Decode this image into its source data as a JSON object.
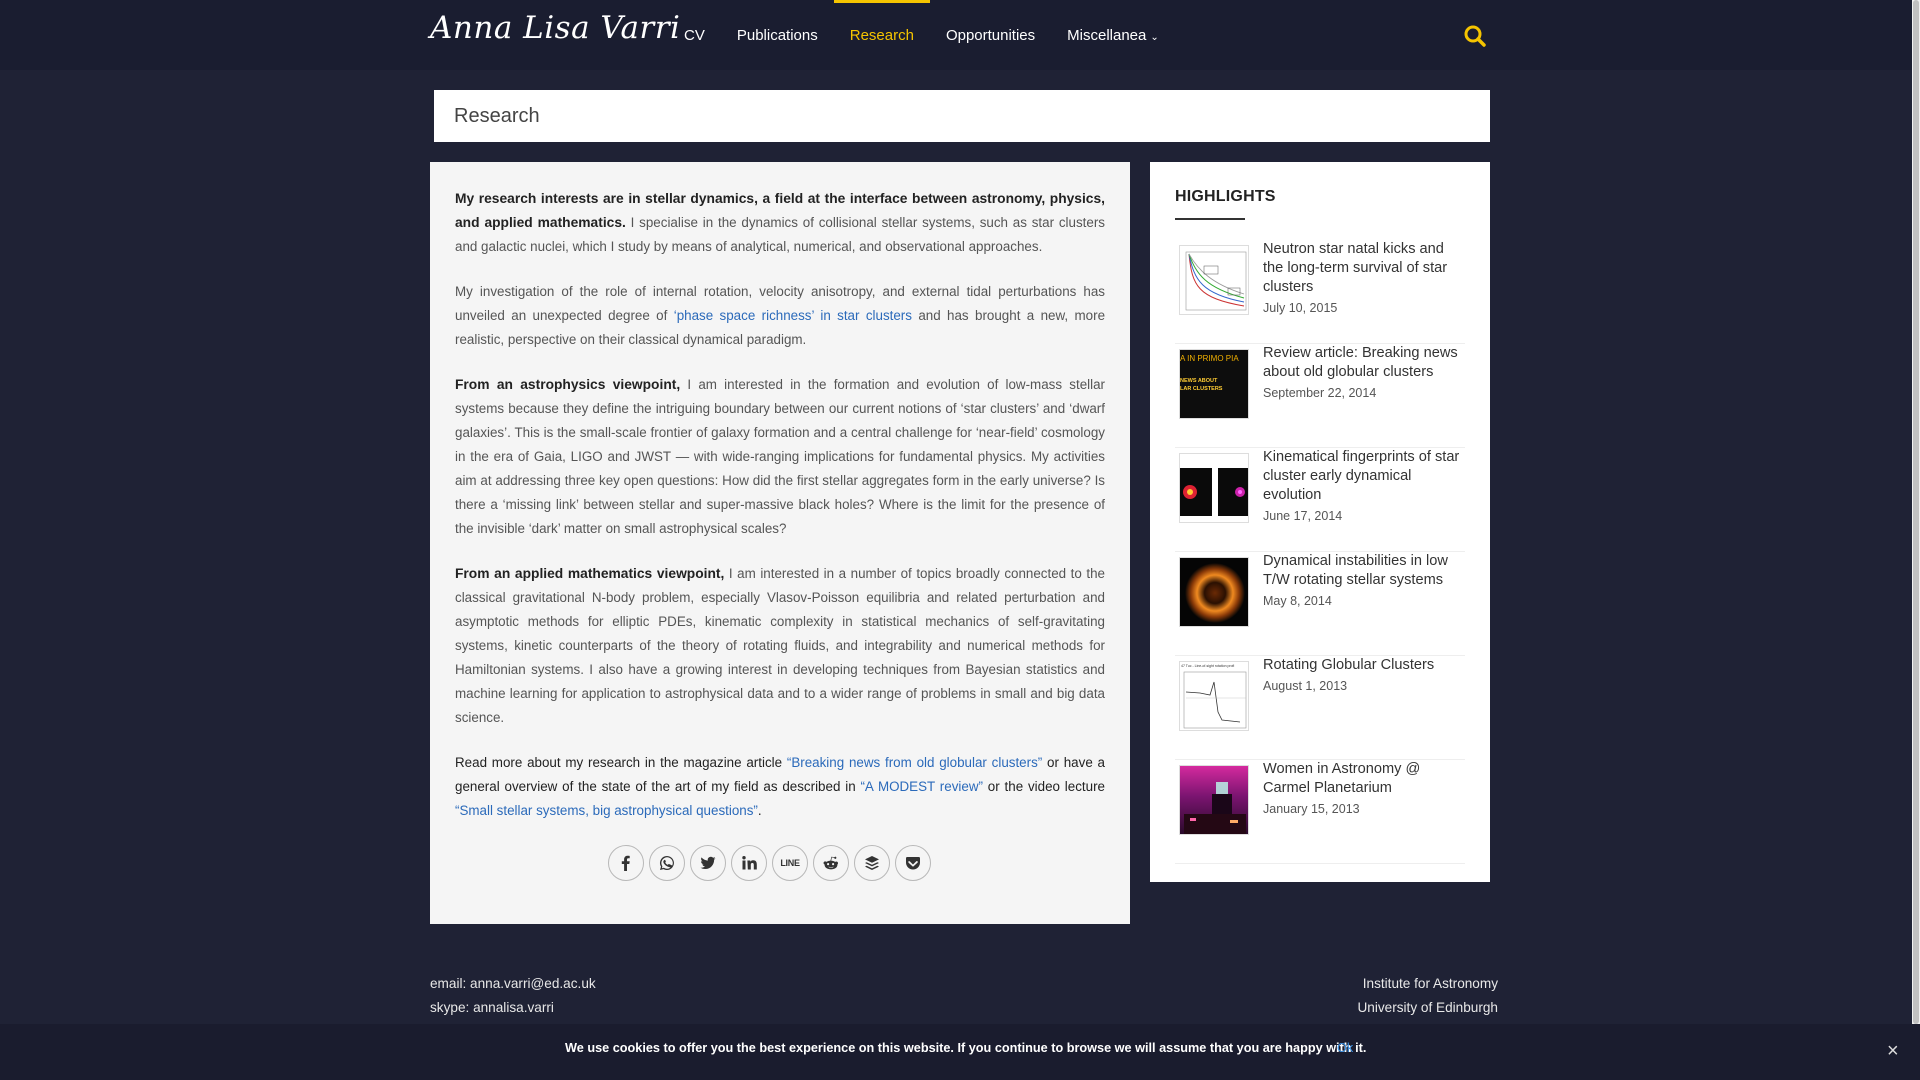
{
  "header": {
    "logo": "Anna Lisa Varri",
    "nav": [
      {
        "label": "CV"
      },
      {
        "label": "Publications"
      },
      {
        "label": "Research"
      },
      {
        "label": "Opportunities"
      },
      {
        "label": "Miscellanea"
      }
    ],
    "active": "Research",
    "accent_color": "#f5c400"
  },
  "page": {
    "title": "Research"
  },
  "article": {
    "p1_bold": "My research interests are in stellar dynamics, a field at the interface between astronomy, physics, and applied mathematics.",
    "p1_rest": " I specialise in the dynamics of collisional stellar systems, such as star clusters and galactic nuclei, which I study by means of analytical, numerical, and observational approaches.",
    "p2_a": "My investigation of the role of internal rotation, velocity anisotropy, and external tidal perturbations has unveiled an unexpected degree of ",
    "p2_link": "‘phase space richness’ in star clusters",
    "p2_b": " and has brought a new, more realistic, perspective on their classical dynamical paradigm.",
    "p3_bold": "From an astrophysics viewpoint,",
    "p3_rest": " I am interested in the formation and evolution of low-mass stellar systems because they define the intriguing boundary between our current notions of ‘star clusters’ and ‘dwarf galaxies’. This is the small-scale frontier of galaxy formation and a central challenge for ‘near-field’ cosmology in the era of Gaia, LIGO and JWST — with wide-ranging implications for fundamental physics. My activities aim at addressing three key open questions: How did the first stellar aggregates form in the early universe? Is there a ‘missing link’ between stellar and super-massive black holes? Where is the limit for the presence of the invisible ‘dark’ matter on small astrophysical scales?",
    "p4_bold": "From an applied mathematics viewpoint,",
    "p4_rest": " I am interested in a number of topics broadly connected to the classical gravitational N-body problem, especially Vlasov-Poisson equilibria and related perturbation and asymptotic methods for elliptic PDEs, kinematic complexity in statistical mechanics of self-gravitating systems, kinetic counterparts of the theory of rotating fluids, and integrability and numerical methods for Hamiltonian systems. I also have a growing interest in developing techniques from Bayesian statistics and machine learning for application to astrophysical data and to a wider range of problems in small and big data science.",
    "p5_a": "Read more about my research in the magazine article ",
    "p5_link1": "“Breaking news from old globular clusters”",
    "p5_b": " or have a general overview of the state of the art of my field as described in ",
    "p5_link2": "“A MODEST review”",
    "p5_c": " or the video lecture ",
    "p5_link3": "“Small stellar systems, big astrophysical questions”",
    "p5_d": ".",
    "link_color": "#2b6aba",
    "share": [
      {
        "icon": "facebook-icon"
      },
      {
        "icon": "whatsapp-icon"
      },
      {
        "icon": "twitter-icon"
      },
      {
        "icon": "linkedin-icon"
      },
      {
        "icon": "line-icon",
        "label": "LINE"
      },
      {
        "icon": "reddit-icon"
      },
      {
        "icon": "buffer-icon"
      },
      {
        "icon": "pocket-icon"
      }
    ]
  },
  "sidebar": {
    "heading": "HIGHLIGHTS",
    "items": [
      {
        "title": "Neutron star natal kicks and the long-term survival of star clusters",
        "date": "July 10, 2015"
      },
      {
        "title": "Review article: Breaking news about old globular clusters",
        "date": "September 22, 2014",
        "thumb_text_1": "A IN PRIMO PIA",
        "thumb_text_2": "NEWS ABOUT",
        "thumb_text_3": "LAR CLUSTERS"
      },
      {
        "title": "Kinematical fingerprints of star cluster early dynamical evolution",
        "date": "June 17, 2014"
      },
      {
        "title": "Dynamical instabilities in low T/W rotating stellar systems",
        "date": "May 8, 2014"
      },
      {
        "title": "Rotating Globular Clusters",
        "date": "August 1, 2013",
        "thumb_text_1": "47 Tuc - Line-of-sight rotation profi"
      },
      {
        "title": "Women in Astronomy @ Carmel Planetarium",
        "date": "January 15, 2013"
      }
    ]
  },
  "footer": {
    "email": "email: anna.varri@ed.ac.uk",
    "skype": "skype: annalisa.varri",
    "inst1": "Institute for Astronomy",
    "inst2": "University of Edinburgh"
  },
  "cookie": {
    "message": "We use cookies to offer you the best experience on this website. If you continue to browse we will assume that you are happy with it.",
    "ok": "Ok",
    "close": "×"
  }
}
